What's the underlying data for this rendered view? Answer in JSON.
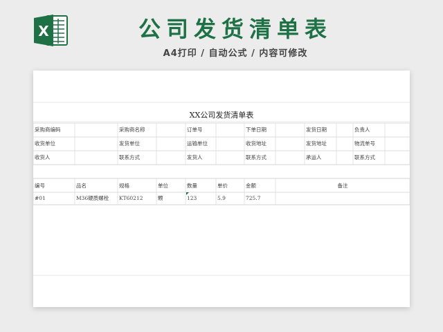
{
  "banner": {
    "title": "公司发货清单表",
    "subtitle": "A4打印 / 自动公式 / 内容可修改",
    "logo_letter": "X",
    "brand_color": "#1e7145",
    "logo_icon": "excel-icon"
  },
  "sheet": {
    "title": "XX公司发货清单表",
    "info_rows": [
      [
        "采购商编码",
        "",
        "采购商名称",
        "",
        "订单号",
        "",
        "下单日期",
        "",
        "发货日期",
        "",
        "负责人",
        ""
      ],
      [
        "收货单位",
        "",
        "发货单位",
        "",
        "运输单位",
        "",
        "收货地址",
        "",
        "发货地址",
        "",
        "物流单号",
        ""
      ],
      [
        "收货人",
        "",
        "联系方式",
        "",
        "发货人",
        "",
        "联系方式",
        "",
        "承运人",
        "",
        "联系方式",
        ""
      ]
    ],
    "item_headers": [
      "编号",
      "品名",
      "规格",
      "单位",
      "数量",
      "单价",
      "金额",
      "备注"
    ],
    "items": [
      [
        "#01",
        "M36硬质螺栓",
        "KT60212",
        "颗",
        "123",
        "5.9",
        "725.7",
        ""
      ]
    ]
  }
}
